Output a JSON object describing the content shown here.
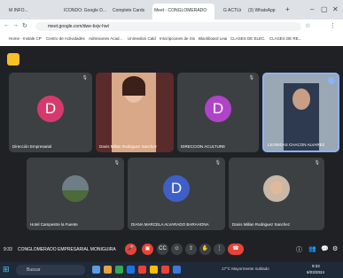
{
  "browser": {
    "tabs": [
      {
        "label": "M INFO..."
      },
      {
        "label": "ICONDO: Google D..."
      },
      {
        "label": "Complete Cards"
      },
      {
        "label": "Meet - CONGLOMERADO"
      },
      {
        "label": "G ACTUAL"
      },
      {
        "label": "(3) WhatsApp"
      }
    ],
    "url": "meet.google.com/dwe-bxjv-hwt",
    "bookmarks": [
      "Home - Instale CP",
      "Centro de Actividades",
      "Admisiones Acad...",
      "Unimedios Caldas",
      "Inscripciones de Sis...",
      "Blackboard Learn",
      "CLASES DE ELEC...",
      "CLASES DE RE..."
    ]
  },
  "meet": {
    "participants": [
      {
        "name": "Dirección Empresarial",
        "initial": "D",
        "color": "#d63a6d"
      },
      {
        "name": "Danis Millan Rodriguez Sanchez",
        "initial": "",
        "color": ""
      },
      {
        "name": "DIRECCION ACULTURE",
        "initial": "D",
        "color": "#b044c8"
      },
      {
        "name": "LEONIDAS CHACON ALVAREZ",
        "initial": "",
        "color": ""
      },
      {
        "name": "Hotel Campestre la Fuente",
        "initial": "",
        "color": ""
      },
      {
        "name": "DIANA MARCELA ALVARADO BARAHONA",
        "initial": "D",
        "color": "#3f5fc8"
      },
      {
        "name": "Danis Millan Rodriguez Sanchez",
        "initial": "",
        "color": ""
      }
    ],
    "time": "9:33",
    "meeting_title": "CONGLOMERADO EMPRESARIAL MONIGUIRA"
  },
  "taskbar": {
    "search_placeholder": "Buscar",
    "weather": "17°C  Mayormente nublado",
    "clock_time": "9:33",
    "clock_date": "6/03/2024"
  }
}
